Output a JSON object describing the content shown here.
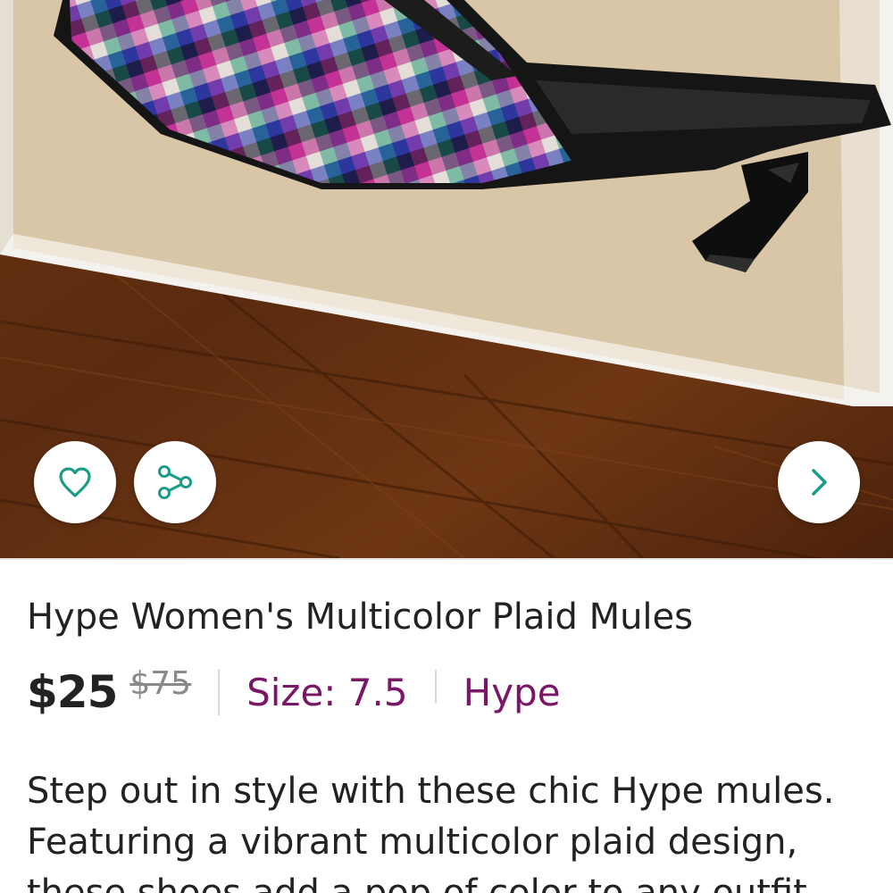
{
  "listing": {
    "title": "Hype Women's Multicolor Plaid Mules",
    "price": "$25",
    "original_price": "$75",
    "size": "Size: 7.5",
    "brand": "Hype",
    "description": "Step out in style with these chic Hype mules. Featuring a vibrant multicolor plaid design, these shoes add a pop of color to any outfit."
  },
  "photo": {
    "subject": "multicolor plaid kitten-heel mule in shoe box on wooden floor"
  },
  "actions": {
    "like_icon": "heart-icon",
    "share_icon": "share-icon",
    "next_icon": "chevron-right-icon"
  },
  "colors": {
    "accent": "#1a9c86",
    "brand_link": "#7b1566",
    "text": "#222222",
    "muted": "#8a8a8a"
  }
}
